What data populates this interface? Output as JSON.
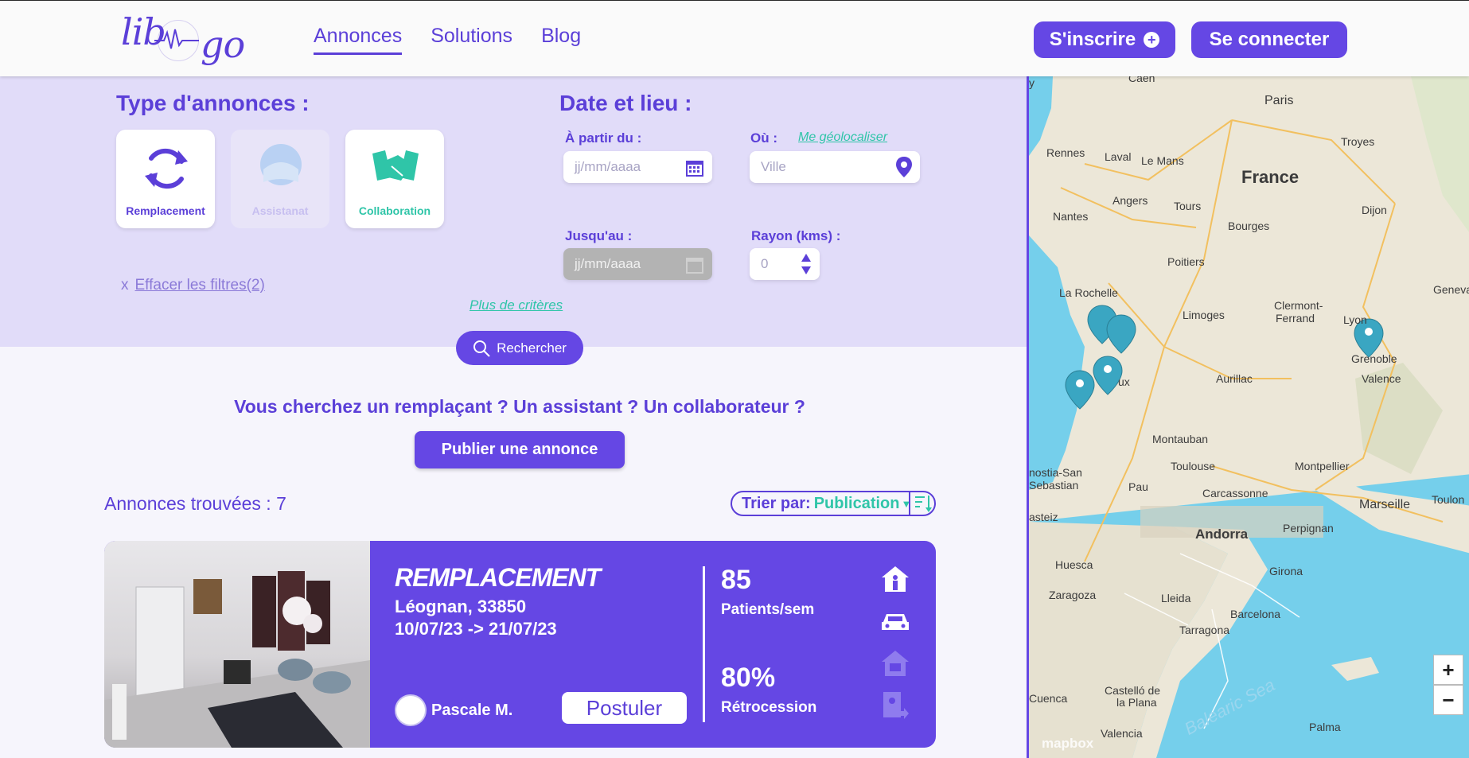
{
  "header": {
    "logo_left": "lib",
    "logo_right": "go",
    "nav": [
      {
        "label": "Annonces",
        "active": true
      },
      {
        "label": "Solutions",
        "active": false
      },
      {
        "label": "Blog",
        "active": false
      }
    ],
    "signup_label": "S'inscrire",
    "login_label": "Se connecter"
  },
  "filters": {
    "type_title": "Type d'annonces :",
    "types": [
      {
        "label": "Remplacement",
        "active": true,
        "icon": "refresh-icon",
        "color": "#5b3fd8"
      },
      {
        "label": "Assistanat",
        "active": false,
        "icon": "person-icon",
        "color": "#bcb2ee"
      },
      {
        "label": "Collaboration",
        "active": true,
        "icon": "handshake-icon",
        "color": "#2fc5a8"
      }
    ],
    "date_place_title": "Date et lieu :",
    "from_label": "À partir du :",
    "from_placeholder": "jj/mm/aaaa",
    "where_label": "Où :",
    "geolocate_label": "Me géolocaliser",
    "city_placeholder": "Ville",
    "until_label": "Jusqu'au :",
    "until_placeholder": "jj/mm/aaaa",
    "radius_label": "Rayon (kms) :",
    "radius_value": "0",
    "clear_x": "x",
    "clear_label": "Effacer les filtres(2)",
    "more_criteria": "Plus de critères",
    "search_label": "Rechercher"
  },
  "cta": {
    "text": "Vous cherchez un remplaçant ? Un assistant ? Un collaborateur ?",
    "publish_label": "Publier une annonce"
  },
  "results": {
    "found_label": "Annonces trouvées : 7",
    "sort_label": "Trier par:",
    "sort_value": "Publication"
  },
  "listing": {
    "type": "REMPLACEMENT",
    "location": "Léognan, 33850",
    "dates": "10/07/23 -> 21/07/23",
    "patients": "85",
    "patients_unit": "Patients/sem",
    "retro": "80%",
    "retro_unit": "Rétrocession",
    "author": "Pascale M.",
    "apply_label": "Postuler"
  },
  "map": {
    "country": "France",
    "sea": "Balearic Sea",
    "attribution": "mapbox",
    "zoom_in": "+",
    "zoom_out": "−",
    "cities": [
      "Caen",
      "Paris",
      "Rennes",
      "Laval",
      "Le Mans",
      "Troyes",
      "Angers",
      "Tours",
      "Nantes",
      "Dijon",
      "Bourges",
      "Poitiers",
      "La Rochelle",
      "Limoges",
      "Clermont-",
      "Ferrand",
      "Geneva",
      "Lyon",
      "Grenoble",
      "Aurillac",
      "Valence",
      "Montauban",
      "Toulouse",
      "Montpellier",
      "Marseille",
      "Toulon",
      "Carcassonne",
      "Perpignan",
      "Andorra",
      "Pau",
      "Huesca",
      "Girona",
      "Zaragoza",
      "Lleida",
      "Barcelona",
      "Tarragona",
      "Castelló de",
      "la Plana",
      "Valencia",
      "Palma",
      "nostia-San",
      "Sebastian",
      "asteiz",
      "Cuenca",
      "ux",
      "y"
    ],
    "marker_color": "#3aa6c2"
  }
}
